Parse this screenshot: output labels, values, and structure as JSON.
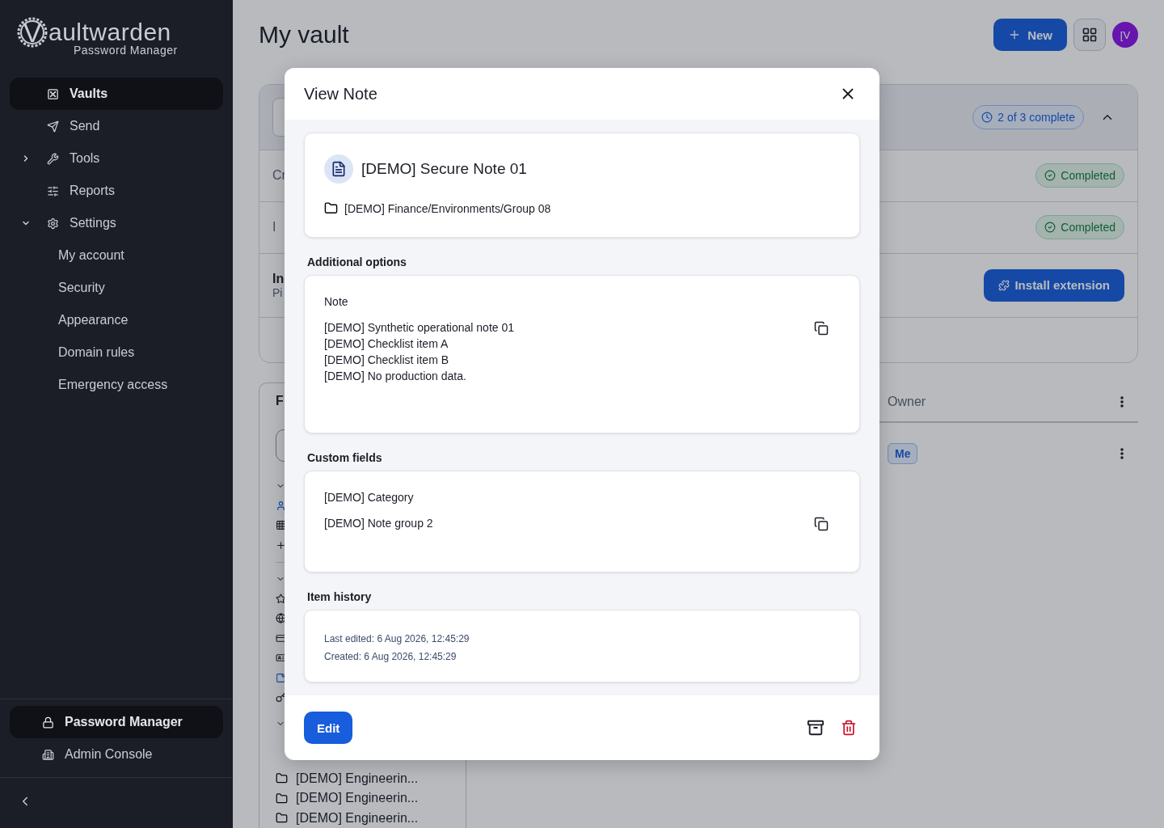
{
  "sidebar": {
    "logo": {
      "mark": "V",
      "name": "aultwarden",
      "subtitle": "Password Manager"
    },
    "nav": [
      {
        "label": "Vaults",
        "selected": true
      },
      {
        "label": "Send",
        "selected": false
      },
      {
        "label": "Tools",
        "selected": false,
        "expanded": false
      },
      {
        "label": "Reports",
        "selected": false
      },
      {
        "label": "Settings",
        "selected": false,
        "expanded": true,
        "children": [
          {
            "label": "My account",
            "selected": false
          },
          {
            "label": "Security",
            "selected": false
          },
          {
            "label": "Appearance",
            "selected": false
          },
          {
            "label": "Domain rules",
            "selected": false
          },
          {
            "label": "Emergency access",
            "selected": false
          }
        ]
      }
    ],
    "products": [
      {
        "label": "Password Manager",
        "selected": true
      },
      {
        "label": "Admin Console",
        "selected": false
      }
    ]
  },
  "header": {
    "title": "My vault",
    "new_button": "New",
    "avatar": "[V"
  },
  "setup_card": {
    "progress": "2 of 3 complete",
    "expanded": true,
    "rows": [
      {
        "title": "Cr",
        "action": {
          "kind": "badge",
          "label": "Completed"
        }
      },
      {
        "title": "I",
        "action": {
          "kind": "badge",
          "label": "Completed"
        }
      },
      {
        "title": "In",
        "subtitle": "Pi",
        "action": {
          "kind": "button",
          "label": "Install extension"
        }
      }
    ]
  },
  "filters": {
    "title": "F",
    "groups": [
      {
        "expanded": true,
        "items": [
          {
            "selected": true
          },
          {
            "selected": false
          },
          {
            "selected": false
          }
        ]
      },
      {
        "expanded": true,
        "items": [
          {
            "selected": false
          },
          {
            "selected": false
          },
          {
            "selected": false
          },
          {
            "selected": false
          },
          {
            "selected": true
          },
          {
            "selected": false
          }
        ]
      }
    ],
    "folders": [
      "[DEMO] Engineerin...",
      "[DEMO] Engineerin...",
      "[DEMO] Engineerin..."
    ]
  },
  "table": {
    "columns": [
      {
        "label": "Owner"
      }
    ],
    "rows": [
      {
        "owner": "Me"
      }
    ]
  },
  "modal": {
    "title": "View Note",
    "item": {
      "name": "[DEMO] Secure Note 01",
      "folder": "[DEMO] Finance/Environments/Group 08"
    },
    "sections": [
      {
        "heading": "Additional options",
        "label": "Note",
        "value": "[DEMO] Synthetic operational note 01\n[DEMO] Checklist item A\n[DEMO] Checklist item B\n[DEMO] No production data."
      },
      {
        "heading": "Custom fields",
        "label": "[DEMO] Category",
        "value": "[DEMO] Note group 2"
      }
    ],
    "history": {
      "heading": "Item history",
      "lines": [
        "Last edited: 6 Aug 2026, 12:45:29",
        "Created: 6 Aug 2026, 12:45:29"
      ]
    },
    "edit_button": "Edit"
  }
}
